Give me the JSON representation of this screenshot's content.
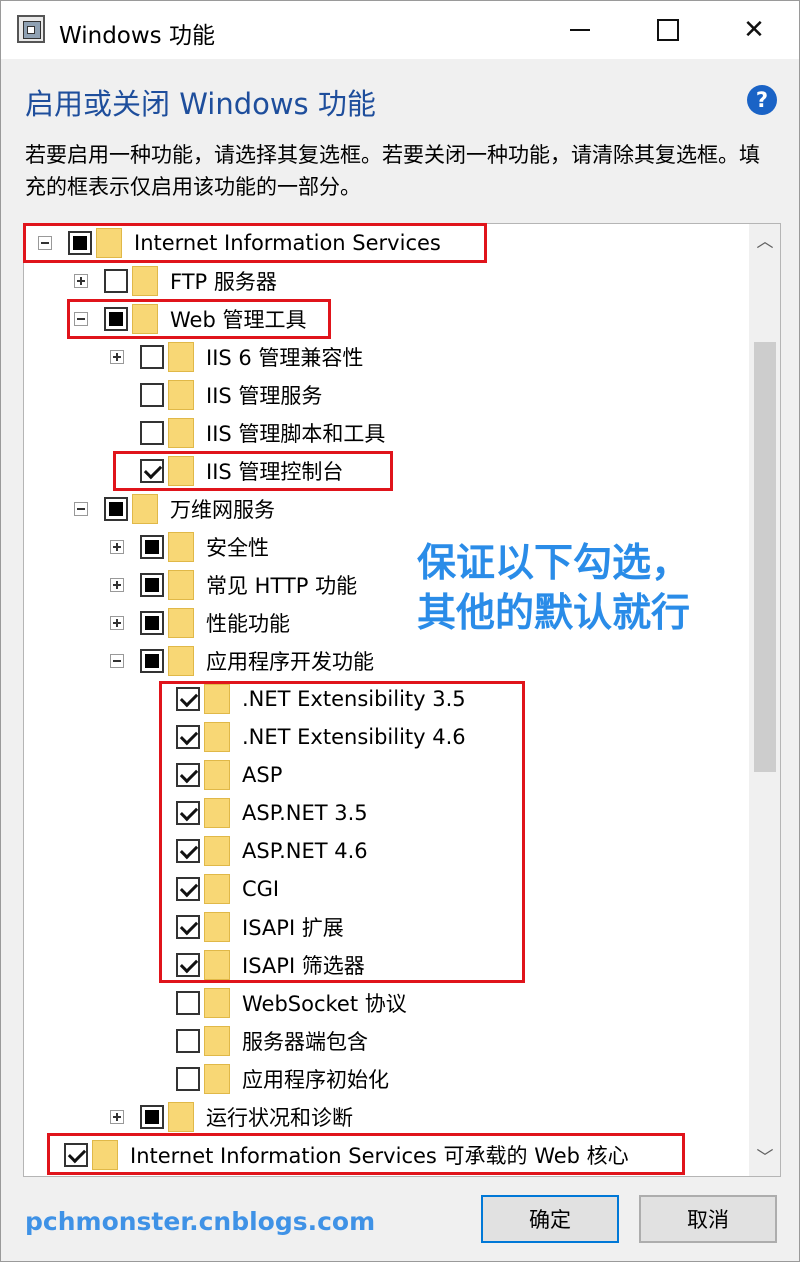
{
  "window": {
    "title": "Windows 功能"
  },
  "header": {
    "heading": "启用或关闭 Windows 功能",
    "description": "若要启用一种功能，请选择其复选框。若要关闭一种功能，请清除其复选框。填充的框表示仅启用该功能的一部分。"
  },
  "help_icon": {
    "glyph": "?"
  },
  "tree": [
    {
      "label": "Internet Information Services",
      "state": "partial",
      "expander": "minus"
    },
    {
      "label": "FTP 服务器",
      "state": "unchecked",
      "expander": "plus"
    },
    {
      "label": "Web 管理工具",
      "state": "partial",
      "expander": "minus"
    },
    {
      "label": "IIS 6 管理兼容性",
      "state": "unchecked",
      "expander": "plus"
    },
    {
      "label": "IIS 管理服务",
      "state": "unchecked",
      "expander": "none"
    },
    {
      "label": "IIS 管理脚本和工具",
      "state": "unchecked",
      "expander": "none"
    },
    {
      "label": "IIS 管理控制台",
      "state": "checked",
      "expander": "none"
    },
    {
      "label": "万维网服务",
      "state": "partial",
      "expander": "minus"
    },
    {
      "label": "安全性",
      "state": "partial",
      "expander": "plus"
    },
    {
      "label": "常见 HTTP 功能",
      "state": "partial",
      "expander": "plus"
    },
    {
      "label": "性能功能",
      "state": "partial",
      "expander": "plus"
    },
    {
      "label": "应用程序开发功能",
      "state": "partial",
      "expander": "minus"
    },
    {
      "label": ".NET Extensibility 3.5",
      "state": "checked",
      "expander": "none"
    },
    {
      "label": ".NET Extensibility 4.6",
      "state": "checked",
      "expander": "none"
    },
    {
      "label": "ASP",
      "state": "checked",
      "expander": "none"
    },
    {
      "label": "ASP.NET 3.5",
      "state": "checked",
      "expander": "none"
    },
    {
      "label": "ASP.NET 4.6",
      "state": "checked",
      "expander": "none"
    },
    {
      "label": "CGI",
      "state": "checked",
      "expander": "none"
    },
    {
      "label": "ISAPI 扩展",
      "state": "checked",
      "expander": "none"
    },
    {
      "label": "ISAPI 筛选器",
      "state": "checked",
      "expander": "none"
    },
    {
      "label": "WebSocket 协议",
      "state": "unchecked",
      "expander": "none"
    },
    {
      "label": "服务器端包含",
      "state": "unchecked",
      "expander": "none"
    },
    {
      "label": "应用程序初始化",
      "state": "unchecked",
      "expander": "none"
    },
    {
      "label": "运行状况和诊断",
      "state": "partial",
      "expander": "plus"
    },
    {
      "label": "Internet Information Services 可承载的 Web 核心",
      "state": "checked",
      "expander": "none"
    }
  ],
  "annotation": {
    "line1": "保证以下勾选，",
    "line2": "其他的默认就行"
  },
  "watermark": "pchmonster.cnblogs.com",
  "buttons": {
    "ok": "确定",
    "cancel": "取消"
  },
  "colors": {
    "highlight": "#e0141b",
    "annotation": "#2a8ce8",
    "heading": "#1e4e9c",
    "folder": "#f8d775"
  }
}
